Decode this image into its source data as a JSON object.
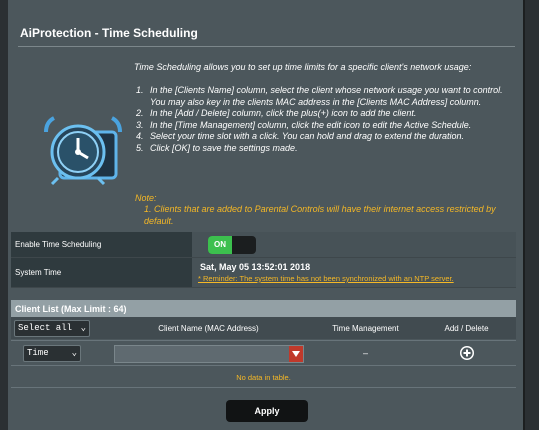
{
  "page": {
    "title": "AiProtection - Time Scheduling",
    "intro": "Time Scheduling allows you to set up time limits for a specific client's network usage:",
    "steps": [
      {
        "num": "1.",
        "text": "In the [Clients Name] column, select the client whose network usage you want to control. You may also key in the clients MAC address in the [Clients MAC Address] column."
      },
      {
        "num": "2.",
        "text": "In the [Add / Delete] column, click the plus(+) icon to add the client."
      },
      {
        "num": "3.",
        "text": "In the [Time Management] column, click the edit icon to edit the Active Schedule."
      },
      {
        "num": "4.",
        "text": "Select your time slot with a click. You can hold and drag to extend the duration."
      },
      {
        "num": "5.",
        "text": "Click [OK] to save the settings made."
      }
    ],
    "note_label": "Note:",
    "note_text": "1. Clients that are added to Parental Controls will have their internet access restricted by default."
  },
  "settings": {
    "enable_label": "Enable Time Scheduling",
    "toggle_state": "ON",
    "system_time_label": "System Time",
    "system_time_value": "Sat, May 05 13:52:01 2018",
    "reminder": "* Reminder: The system time has not been synchronized with an NTP server."
  },
  "client_list": {
    "header": "Client List (Max Limit : 64)",
    "select_all": "Select all",
    "columns": {
      "name": "Client Name (MAC Address)",
      "time_mgmt": "Time Management",
      "add_delete": "Add / Delete"
    },
    "row": {
      "type_select": "Time",
      "time_mgmt_value": "–"
    },
    "empty_message": "No data in table."
  },
  "actions": {
    "apply": "Apply"
  },
  "colors": {
    "accent_on": "#3cc04e",
    "note": "#f5b826",
    "mac_dropdown": "#c0392b"
  },
  "icons": [
    "clock-icon",
    "chevron-down-icon",
    "plus-circle-icon",
    "triangle-down-icon"
  ]
}
